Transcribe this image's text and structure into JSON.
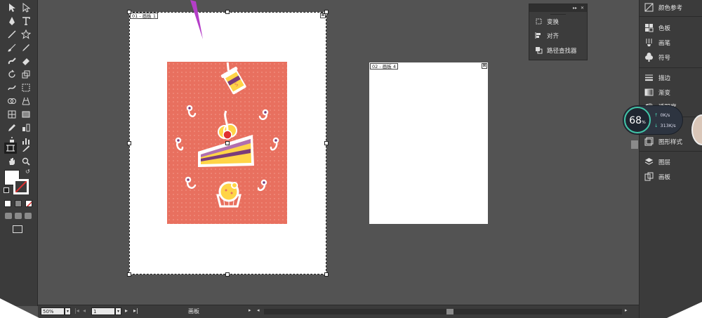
{
  "artboards": [
    {
      "label": "01 - 画板 1",
      "close": "⊠"
    },
    {
      "label": "02 - 画板 4",
      "close": "⊠"
    }
  ],
  "float_panel": {
    "controls": [
      "▸▸",
      "✕"
    ],
    "items": [
      {
        "label": "变换",
        "icon": "transform-icon"
      },
      {
        "label": "对齐",
        "icon": "align-icon"
      },
      {
        "label": "路径查找器",
        "icon": "pathfinder-icon"
      }
    ]
  },
  "right_panel": {
    "items": [
      {
        "label": "颜色参考",
        "icon": "color-guide-icon"
      },
      {
        "label": "色板",
        "icon": "swatches-icon"
      },
      {
        "label": "画笔",
        "icon": "brush-icon"
      },
      {
        "label": "符号",
        "icon": "symbol-icon"
      },
      {
        "label": "描边",
        "icon": "stroke-icon"
      },
      {
        "label": "渐变",
        "icon": "gradient-icon"
      },
      {
        "label": "透明度",
        "icon": "transparency-icon"
      },
      {
        "label": "图形样式",
        "icon": "graphic-styles-icon"
      },
      {
        "label": "图层",
        "icon": "layers-icon"
      },
      {
        "label": "画板",
        "icon": "artboards-icon"
      }
    ]
  },
  "speed_widget": {
    "percent": "68",
    "percent_sign": "%",
    "upload": "0K/s",
    "download": "313K/s"
  },
  "status_bar": {
    "zoom": "50%",
    "page": "1",
    "tool_name": "画板"
  },
  "colors": {
    "canvas_bg": "#535353",
    "panel_bg": "#3b3b3b",
    "poster_bg": "#e8705f",
    "accent": "#41c6a8"
  }
}
